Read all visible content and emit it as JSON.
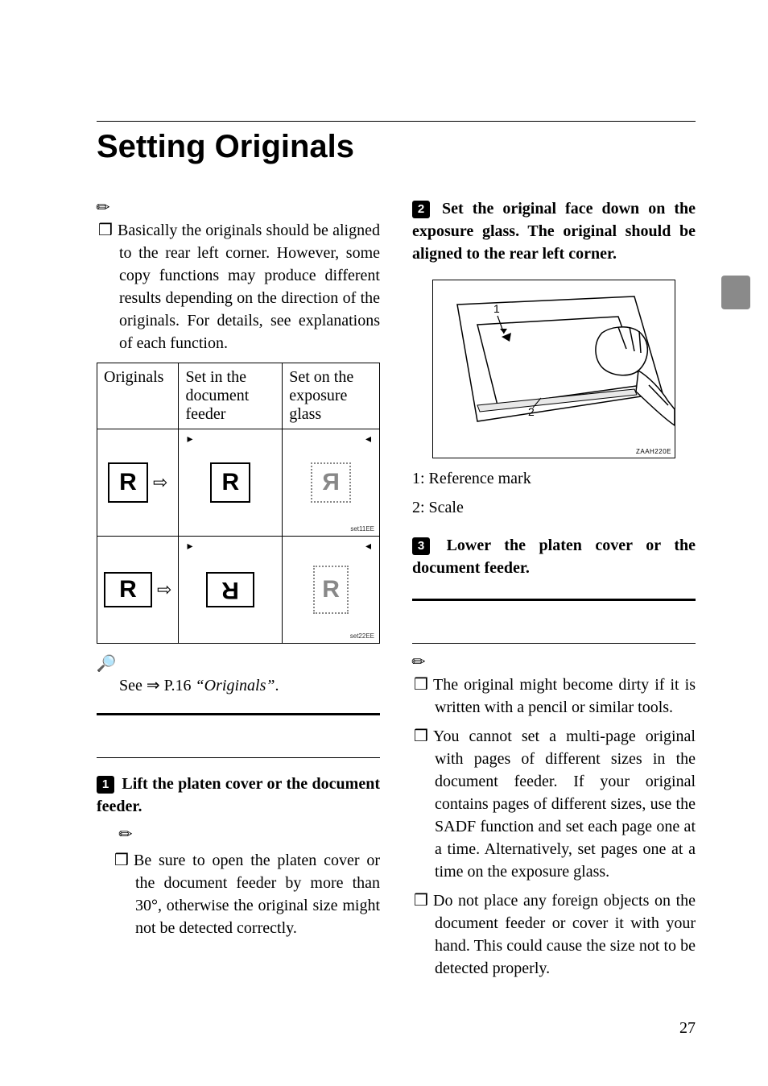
{
  "page_number": "27",
  "title": "Setting Originals",
  "intro_note": "Basically the originals should be aligned to the rear left corner. However, some copy functions may produce different results depending on the direction of the originals. For details, see explanations of each function.",
  "table": {
    "headers": [
      "Originals",
      "Set in the document feeder",
      "Set on the exposure glass"
    ],
    "row_captions": [
      "set11EE",
      "set22EE"
    ]
  },
  "glyph_letter": "R",
  "reference": {
    "prefix": "See ⇒ P.16 ",
    "cite": "“Originals”",
    "suffix": "."
  },
  "left_steps": {
    "one": {
      "num": "1",
      "text": "Lift the platen cover or the document feeder."
    },
    "note": "Be sure to open the platen cover or the document feeder by more than 30°, otherwise the original size might not be detected correctly."
  },
  "right_steps": {
    "two": {
      "num": "2",
      "text": "Set the original face down on the exposure glass. The original should be aligned to the rear left corner."
    },
    "legend1": "1: Reference mark",
    "legend2": "2: Scale",
    "three": {
      "num": "3",
      "text": "Lower the platen cover or the document feeder."
    },
    "fig_caption": "ZAAH220E"
  },
  "adf_notes": [
    "The original might become dirty if it is written with a pencil or similar tools.",
    "You cannot set a multi-page original with pages of different sizes in the document feeder. If your original contains pages of different sizes, use the SADF function and set each page one at a time. Alternatively, set pages one at a time on the exposure glass.",
    "Do not place any foreign objects on the document feeder or cover it with your hand. This could cause the size not to be detected properly."
  ]
}
